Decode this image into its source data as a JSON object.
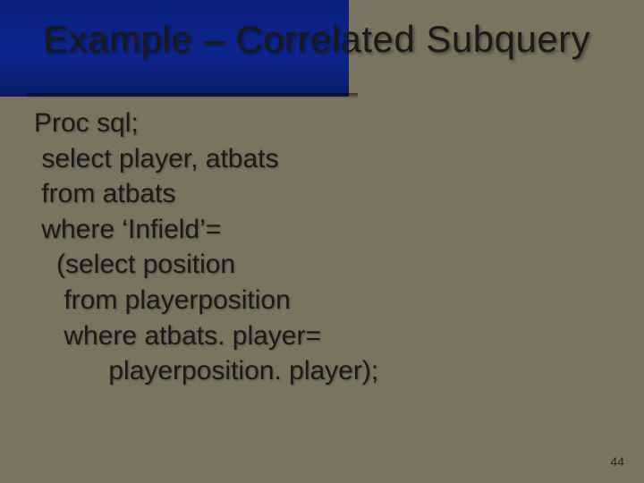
{
  "title": "Example – Correlated Subquery",
  "code": {
    "l1": "Proc sql;",
    "l2": " select player, atbats",
    "l3": " from atbats",
    "l4": " where ‘Infield’=",
    "l5": "   (select position",
    "l6": "    from playerposition",
    "l7": "    where atbats. player=",
    "l8": "          playerposition. player);"
  },
  "slide_number": "44"
}
